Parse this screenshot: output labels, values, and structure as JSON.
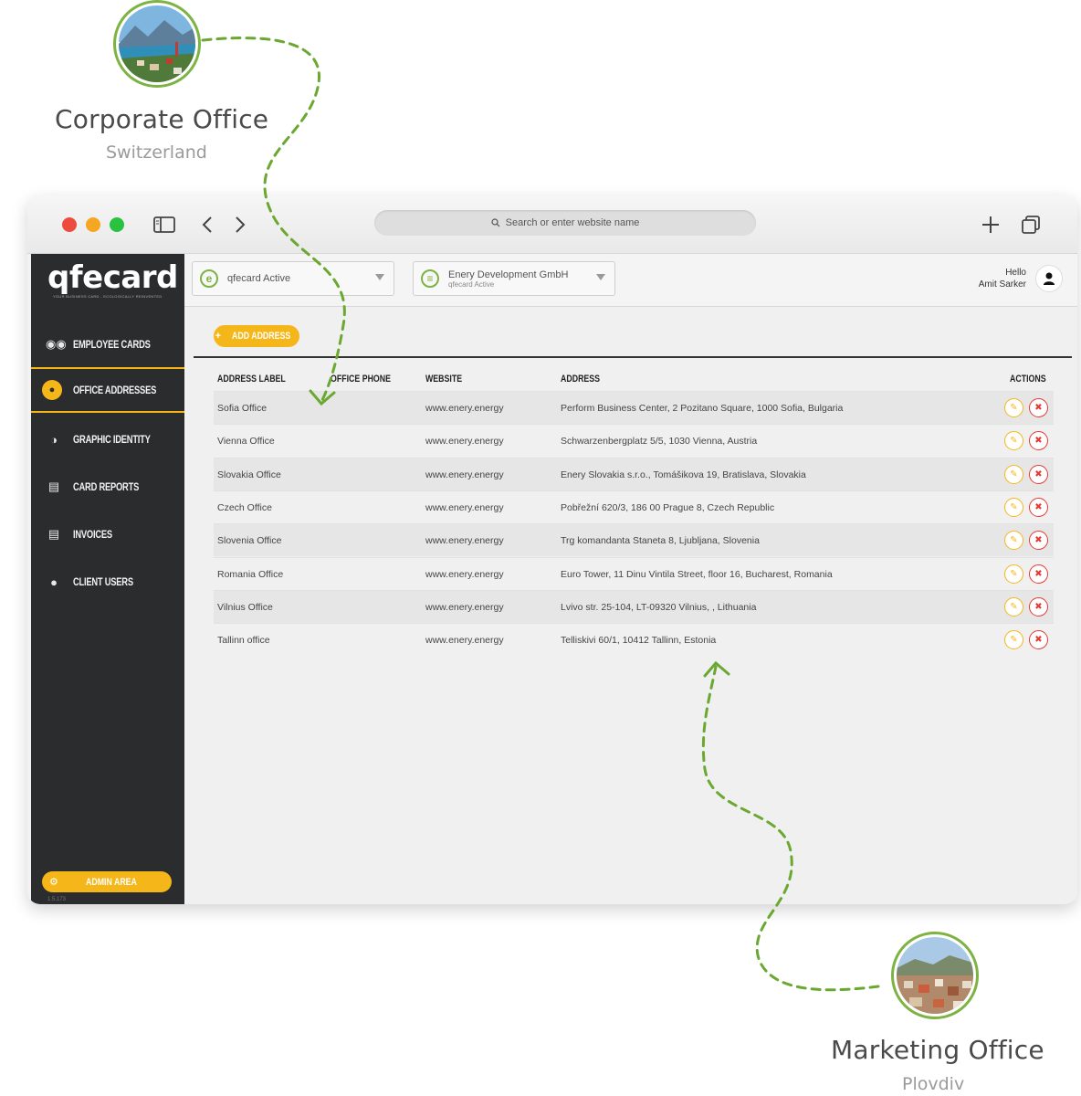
{
  "locations": {
    "corporate": {
      "title": "Corporate Office",
      "subtitle": "Switzerland"
    },
    "marketing": {
      "title": "Marketing Office",
      "subtitle": "Plovdiv"
    }
  },
  "browser": {
    "url_placeholder": "Search or enter website name",
    "traffic_lights": [
      "#ee4b3f",
      "#f5a623",
      "#27c23f"
    ]
  },
  "brand": {
    "logo": "qfecard",
    "tagline": "YOUR BUSINESS CARD - ECOLOGICALLY REINVENTED",
    "accent": "#f5b619",
    "green": "#7cb342",
    "sidebar_bg": "#2b2c2e"
  },
  "sidebar": {
    "items": [
      {
        "label": "EMPLOYEE CARDS",
        "icon": "users-icon",
        "active": false
      },
      {
        "label": "OFFICE ADDRESSES",
        "icon": "location-pin-icon",
        "active": true
      },
      {
        "label": "GRAPHIC IDENTITY",
        "icon": "palette-icon",
        "active": false
      },
      {
        "label": "CARD REPORTS",
        "icon": "bar-chart-icon",
        "active": false
      },
      {
        "label": "INVOICES",
        "icon": "document-icon",
        "active": false
      },
      {
        "label": "CLIENT USERS",
        "icon": "user-gear-icon",
        "active": false
      }
    ],
    "admin_label": "ADMIN AREA",
    "version": "1.5.173"
  },
  "topbar": {
    "select1": {
      "label": "qfecard Active"
    },
    "select2": {
      "label": "Enery Development GmbH",
      "sub": "qfecard Active"
    },
    "greeting": "Hello",
    "user_name": "Amit Sarker"
  },
  "main": {
    "add_button": "ADD ADDRESS",
    "columns": [
      "ADDRESS LABEL",
      "OFFICE PHONE",
      "WEBSITE",
      "ADDRESS",
      "ACTIONS"
    ],
    "rows": [
      {
        "label": "Sofia Office",
        "phone": "",
        "website": "www.enery.energy",
        "address": "Perform Business Center, 2 Pozitano Square, 1000 Sofia, Bulgaria"
      },
      {
        "label": "Vienna Office",
        "phone": "",
        "website": "www.enery.energy",
        "address": "Schwarzenbergplatz 5/5, 1030 Vienna, Austria"
      },
      {
        "label": "Slovakia Office",
        "phone": "",
        "website": "www.enery.energy",
        "address": "Enery Slovakia s.r.o., Tomášikova 19, Bratislava, Slovakia"
      },
      {
        "label": "Czech Office",
        "phone": "",
        "website": "www.enery.energy",
        "address": "Pobřežní 620/3, 186 00 Prague 8, Czech Republic"
      },
      {
        "label": "Slovenia Office",
        "phone": "",
        "website": "www.enery.energy",
        "address": "Trg komandanta Staneta 8, Ljubljana, Slovenia"
      },
      {
        "label": "Romania Office",
        "phone": "",
        "website": "www.enery.energy",
        "address": "Euro Tower, 11 Dinu Vintila Street, floor 16, Bucharest, Romania"
      },
      {
        "label": "Vilnius Office",
        "phone": "",
        "website": "www.enery.energy",
        "address": "Lvivo str. 25-104, LT-09320 Vilnius, , Lithuania"
      },
      {
        "label": "Tallinn office",
        "phone": "",
        "website": "www.enery.energy",
        "address": "Telliskivi 60/1, 10412 Tallinn, Estonia"
      }
    ]
  }
}
